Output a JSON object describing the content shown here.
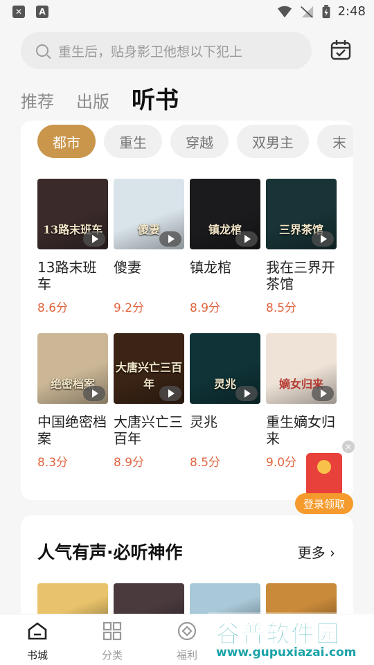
{
  "status_bar": {
    "time": "2:48"
  },
  "search": {
    "placeholder": "重生后，贴身影卫他想以下犯上"
  },
  "tabs": [
    {
      "label": "推荐"
    },
    {
      "label": "出版"
    },
    {
      "label": "听书"
    }
  ],
  "categories": [
    {
      "label": "都市"
    },
    {
      "label": "重生"
    },
    {
      "label": "穿越"
    },
    {
      "label": "双男主"
    },
    {
      "label": "末"
    }
  ],
  "books": [
    {
      "title": "13路末班车",
      "score": "8.6分",
      "cover_text": "13路末班车",
      "cover_color": "#3a2a2a"
    },
    {
      "title": "傻妻",
      "score": "9.2分",
      "cover_text": "傻妻",
      "cover_color": "#d9e3ea"
    },
    {
      "title": "镇龙棺",
      "score": "8.9分",
      "cover_text": "镇龙棺",
      "cover_color": "#1b1b1e"
    },
    {
      "title": "我在三界开茶馆",
      "score": "8.5分",
      "cover_text": "三界茶馆",
      "cover_color": "#183436"
    },
    {
      "title": "中国绝密档案",
      "score": "8.3分",
      "cover_text": "绝密档案",
      "cover_color": "#cbb796"
    },
    {
      "title": "大唐兴亡三百年",
      "score": "8.9分",
      "cover_text": "大唐兴亡三百年",
      "cover_color": "#3b2415"
    },
    {
      "title": "灵兆",
      "score": "8.5分",
      "cover_text": "灵兆",
      "cover_color": "#0f3337"
    },
    {
      "title": "重生嫡女归来",
      "score": "9.0分",
      "cover_text": "嫡女归来",
      "cover_color": "#efe3d8"
    }
  ],
  "red_packet": {
    "close": "×",
    "button": "登录领取"
  },
  "section2": {
    "title": "人气有声·必听神作",
    "more": "更多 ›",
    "covers": [
      {
        "color": "#e9c36b"
      },
      {
        "color": "#4a3a3e"
      },
      {
        "color": "#a9c8d8"
      },
      {
        "color": "#c98a3a"
      }
    ]
  },
  "bottom_nav": [
    {
      "label": "书城"
    },
    {
      "label": "分类"
    },
    {
      "label": "福利"
    }
  ],
  "watermark": {
    "main": "谷普软件园",
    "sub": "www.gupuxiazai.com"
  }
}
